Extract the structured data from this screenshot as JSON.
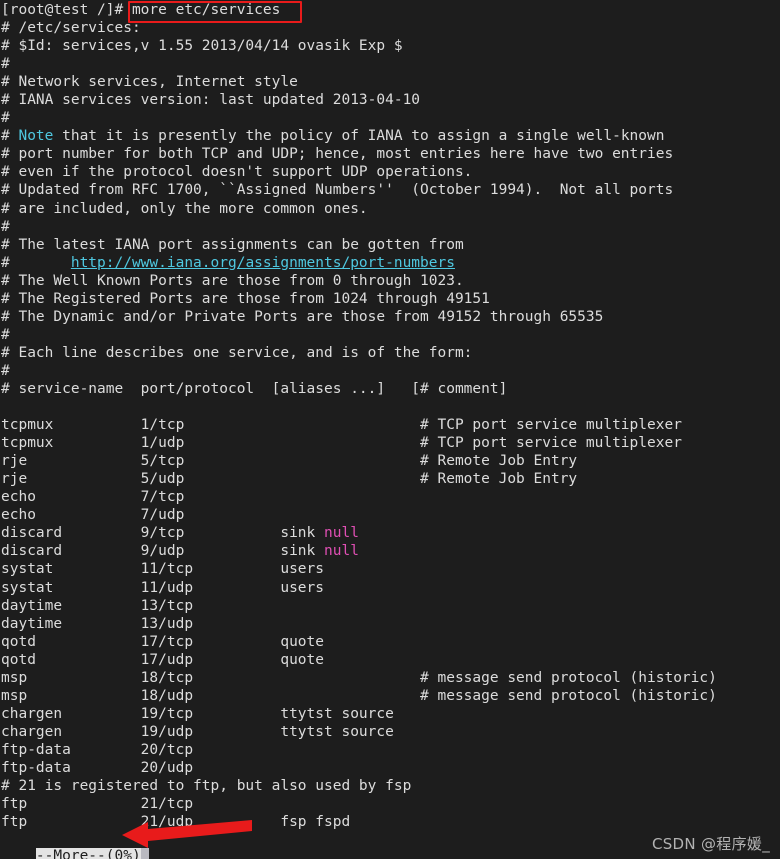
{
  "terminal": {
    "background_color": "#1d1d1d",
    "foreground_color": "#dcdcdc",
    "prompt": "[root@test /]# ",
    "command": "more etc/services",
    "columns": 80
  },
  "annotations": {
    "box_color": "#e81b1b",
    "arrow_color": "#e81b1b",
    "box_target": "more etc/services",
    "arrow_target": "--More--(0%)"
  },
  "watermark": {
    "text": "CSDN @程序媛_"
  },
  "status_line": {
    "label": "--More--(0%)",
    "cursor": " "
  },
  "lines": [
    {
      "id": "prompt-line",
      "segments": [
        {
          "text": "[root@test /]# ",
          "style": "white"
        },
        {
          "text": "more etc/services",
          "style": "white"
        }
      ]
    },
    {
      "id": "l02",
      "segments": [
        {
          "text": "# /etc/services:",
          "style": "white"
        }
      ]
    },
    {
      "id": "l03",
      "segments": [
        {
          "text": "# $Id: services,v 1.55 2013/04/14 ovasik Exp $",
          "style": "white"
        }
      ]
    },
    {
      "id": "l04",
      "segments": [
        {
          "text": "#",
          "style": "white"
        }
      ]
    },
    {
      "id": "l05",
      "segments": [
        {
          "text": "# Network services, Internet style",
          "style": "white"
        }
      ]
    },
    {
      "id": "l06",
      "segments": [
        {
          "text": "# IANA services version: last updated 2013-04-10",
          "style": "white"
        }
      ]
    },
    {
      "id": "l07",
      "segments": [
        {
          "text": "#",
          "style": "white"
        }
      ]
    },
    {
      "id": "l08",
      "segments": [
        {
          "text": "# ",
          "style": "white"
        },
        {
          "text": "Note",
          "style": "cyan"
        },
        {
          "text": " that it is presently the policy of IANA to assign a single well-known",
          "style": "white"
        }
      ]
    },
    {
      "id": "l09",
      "segments": [
        {
          "text": "# port number for both TCP and UDP; hence, most entries here have two entries",
          "style": "white"
        }
      ]
    },
    {
      "id": "l10",
      "segments": [
        {
          "text": "# even if the protocol doesn't support UDP operations.",
          "style": "white"
        }
      ]
    },
    {
      "id": "l11",
      "segments": [
        {
          "text": "# Updated from RFC 1700, ``Assigned Numbers''  (October 1994).  Not all ports",
          "style": "white"
        }
      ]
    },
    {
      "id": "l12",
      "segments": [
        {
          "text": "# are included, only the more common ones.",
          "style": "white"
        }
      ]
    },
    {
      "id": "l13",
      "segments": [
        {
          "text": "#",
          "style": "white"
        }
      ]
    },
    {
      "id": "l14",
      "segments": [
        {
          "text": "# The latest IANA port assignments can be gotten from",
          "style": "white"
        }
      ]
    },
    {
      "id": "l15",
      "segments": [
        {
          "text": "#       ",
          "style": "white"
        },
        {
          "text": "http://www.iana.org/assignments/port-numbers",
          "style": "cyan-underline"
        }
      ]
    },
    {
      "id": "l16",
      "segments": [
        {
          "text": "# The Well Known Ports are those from 0 through 1023.",
          "style": "white"
        }
      ]
    },
    {
      "id": "l17",
      "segments": [
        {
          "text": "# The Registered Ports are those from 1024 through 49151",
          "style": "white"
        }
      ]
    },
    {
      "id": "l18",
      "segments": [
        {
          "text": "# The Dynamic and/or Private Ports are those from 49152 through 65535",
          "style": "white"
        }
      ]
    },
    {
      "id": "l19",
      "segments": [
        {
          "text": "#",
          "style": "white"
        }
      ]
    },
    {
      "id": "l20",
      "segments": [
        {
          "text": "# Each line describes one service, and is of the form:",
          "style": "white"
        }
      ]
    },
    {
      "id": "l21",
      "segments": [
        {
          "text": "#",
          "style": "white"
        }
      ]
    },
    {
      "id": "l22",
      "segments": [
        {
          "text": "# service-name  port/protocol  [aliases ...]   [# comment]",
          "style": "white"
        }
      ]
    },
    {
      "id": "l23",
      "segments": [
        {
          "text": "",
          "style": "white"
        }
      ]
    },
    {
      "id": "l24",
      "segments": [
        {
          "text": "tcpmux          1/tcp                           # TCP port service multiplexer",
          "style": "white"
        }
      ]
    },
    {
      "id": "l25",
      "segments": [
        {
          "text": "tcpmux          1/udp                           # TCP port service multiplexer",
          "style": "white"
        }
      ]
    },
    {
      "id": "l26",
      "segments": [
        {
          "text": "rje             5/tcp                           # Remote Job Entry",
          "style": "white"
        }
      ]
    },
    {
      "id": "l27",
      "segments": [
        {
          "text": "rje             5/udp                           # Remote Job Entry",
          "style": "white"
        }
      ]
    },
    {
      "id": "l28",
      "segments": [
        {
          "text": "echo            7/tcp",
          "style": "white"
        }
      ]
    },
    {
      "id": "l29",
      "segments": [
        {
          "text": "echo            7/udp",
          "style": "white"
        }
      ]
    },
    {
      "id": "l30",
      "segments": [
        {
          "text": "discard         9/tcp           sink ",
          "style": "white"
        },
        {
          "text": "null",
          "style": "magenta"
        }
      ]
    },
    {
      "id": "l31",
      "segments": [
        {
          "text": "discard         9/udp           sink ",
          "style": "white"
        },
        {
          "text": "null",
          "style": "magenta"
        }
      ]
    },
    {
      "id": "l32",
      "segments": [
        {
          "text": "systat          11/tcp          users",
          "style": "white"
        }
      ]
    },
    {
      "id": "l33",
      "segments": [
        {
          "text": "systat          11/udp          users",
          "style": "white"
        }
      ]
    },
    {
      "id": "l34",
      "segments": [
        {
          "text": "daytime         13/tcp",
          "style": "white"
        }
      ]
    },
    {
      "id": "l35",
      "segments": [
        {
          "text": "daytime         13/udp",
          "style": "white"
        }
      ]
    },
    {
      "id": "l36",
      "segments": [
        {
          "text": "qotd            17/tcp          quote",
          "style": "white"
        }
      ]
    },
    {
      "id": "l37",
      "segments": [
        {
          "text": "qotd            17/udp          quote",
          "style": "white"
        }
      ]
    },
    {
      "id": "l38",
      "segments": [
        {
          "text": "msp             18/tcp                          # message send protocol (historic)",
          "style": "white"
        }
      ]
    },
    {
      "id": "l39",
      "segments": [
        {
          "text": "msp             18/udp                          # message send protocol (historic)",
          "style": "white"
        }
      ]
    },
    {
      "id": "l40",
      "segments": [
        {
          "text": "chargen         19/tcp          ttytst source",
          "style": "white"
        }
      ]
    },
    {
      "id": "l41",
      "segments": [
        {
          "text": "chargen         19/udp          ttytst source",
          "style": "white"
        }
      ]
    },
    {
      "id": "l42",
      "segments": [
        {
          "text": "ftp-data        20/tcp",
          "style": "white"
        }
      ]
    },
    {
      "id": "l43",
      "segments": [
        {
          "text": "ftp-data        20/udp",
          "style": "white"
        }
      ]
    },
    {
      "id": "l44",
      "segments": [
        {
          "text": "# 21 is registered to ftp, but also used by fsp",
          "style": "white"
        }
      ]
    },
    {
      "id": "l45",
      "segments": [
        {
          "text": "ftp             21/tcp",
          "style": "white"
        }
      ]
    },
    {
      "id": "l46",
      "segments": [
        {
          "text": "ftp             21/udp          fsp fspd",
          "style": "white"
        }
      ]
    }
  ]
}
